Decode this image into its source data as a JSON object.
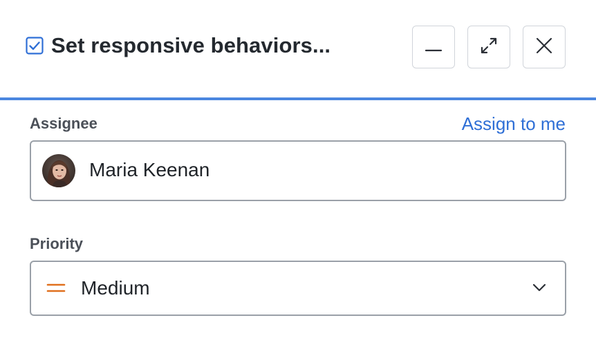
{
  "header": {
    "title": "Set responsive behaviors...",
    "accent_color": "#4a86df",
    "checkbox_icon": "checkbox-checked-icon",
    "buttons": {
      "minimize_icon": "minimize-icon",
      "expand_icon": "expand-icon",
      "close_icon": "close-icon"
    }
  },
  "assignee": {
    "label": "Assignee",
    "assign_link": "Assign to me",
    "value": "Maria Keenan",
    "avatar_icon": "user-avatar"
  },
  "priority": {
    "label": "Priority",
    "value": "Medium",
    "icon": "priority-medium-icon",
    "icon_color": "#e0701e",
    "dropdown_icon": "chevron-down-icon"
  },
  "colors": {
    "link": "#2f6fd6",
    "label": "#4b5058",
    "border": "#9aa0a8"
  }
}
